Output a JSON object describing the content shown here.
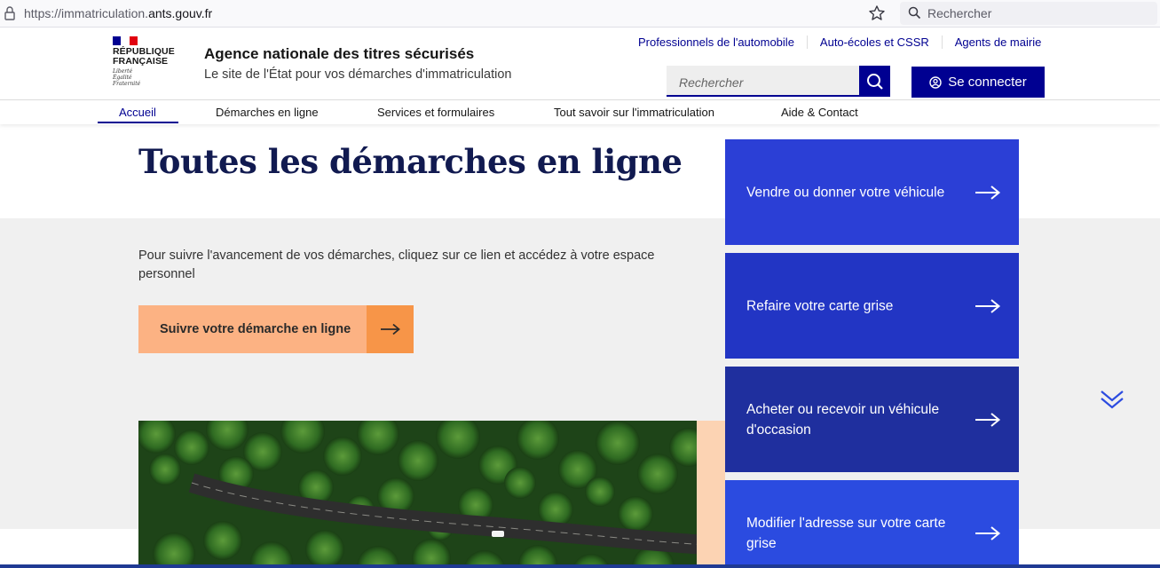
{
  "browser": {
    "url_prefix": "https://immatriculation.",
    "url_domain": "ants.gouv.fr",
    "search_placeholder": "Rechercher"
  },
  "header": {
    "logo_line1": "RÉPUBLIQUE",
    "logo_line2": "FRANÇAISE",
    "motto": [
      "Liberté",
      "Égalité",
      "Fraternité"
    ],
    "agency_name": "Agence nationale des titres sécurisés",
    "agency_tagline": "Le site de l'État pour vos démarches d'immatriculation",
    "top_links": [
      "Professionnels de l'automobile",
      "Auto-écoles et CSSR",
      "Agents de mairie"
    ],
    "search_placeholder": "Rechercher",
    "login_label": "Se connecter"
  },
  "nav": {
    "items": [
      "Accueil",
      "Démarches en ligne",
      "Services et formulaires",
      "Tout savoir sur l'immatriculation",
      "Aide & Contact"
    ],
    "active": "Accueil"
  },
  "main": {
    "title": "Toutes les démarches en ligne",
    "intro": "Pour suivre l'avancement de vos démarches, cliquez sur ce lien et accédez à votre espace personnel",
    "follow_button": "Suivre votre démarche en ligne"
  },
  "cards": [
    {
      "label": "Vendre ou donner votre véhicule",
      "color": "#2b3fd6"
    },
    {
      "label": "Refaire votre carte grise",
      "color": "#2235c4"
    },
    {
      "label": "Acheter ou recevoir un véhicule d'occasion",
      "color": "#1f2f9e"
    },
    {
      "label": "Modifier l'adresse sur votre carte grise",
      "color": "#2b4be0"
    }
  ],
  "colors": {
    "primary": "#000091",
    "title": "#111a50",
    "accent_orange": "#f79548",
    "accent_peach": "#fcb283",
    "grey_bg": "#f0f0f0",
    "chevron": "#2b4be0"
  }
}
